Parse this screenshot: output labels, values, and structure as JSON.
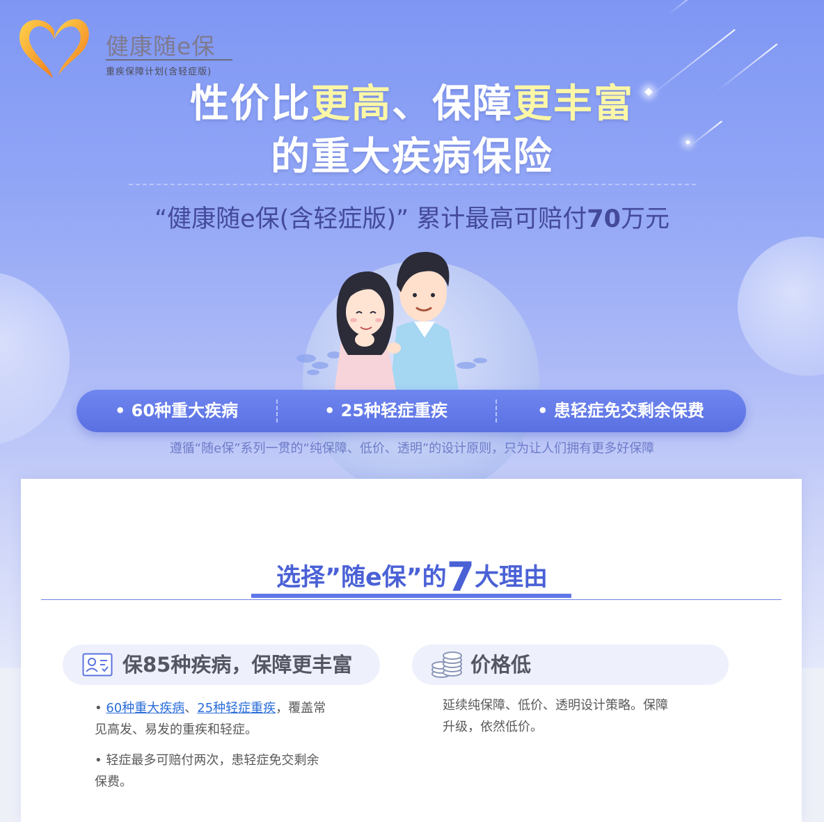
{
  "logo": {
    "name": "健康随e保",
    "subtitle": "重疾保障计划(含轻症版)"
  },
  "headline": {
    "line1_part1": "性价比",
    "line1_hl1": "更高",
    "line1_part2": "、保障",
    "line1_hl2": "更丰富",
    "line2": "的重大疾病保险",
    "highlight_color": "#fbf7a6"
  },
  "claim": {
    "prefix": "“健康随e保(含轻症版)”  累计最高可赔付",
    "amount": "70",
    "unit": "万元"
  },
  "pill": {
    "items": [
      "• 60种重大疾病",
      "• 25种轻症重疾",
      "• 患轻症免交剩余保费"
    ]
  },
  "tagline": "遵循“随e保”系列一贯的“纯保障、低价、透明”的设计原则，只为让人们拥有更多好保障",
  "reasons": {
    "title_prefix": "选择”随e保”的",
    "title_number": "7",
    "title_suffix": "大理由"
  },
  "features": [
    {
      "icon": "id-card-check-icon",
      "title": "保85种疾病，保障更丰富",
      "bullet1_prefix": "• ",
      "bullet1_link1": "60种重大疾病",
      "bullet1_sep": "、",
      "bullet1_link2": "25种轻症重疾",
      "bullet1_rest1": "，覆盖常",
      "bullet1_rest2": "见高发、易发的重疾和轻症。",
      "bullet2_line1": "• 轻症最多可赔付两次，患轻症免交剩余",
      "bullet2_line2": "保费。"
    },
    {
      "icon": "coins-icon",
      "title": "价格低",
      "text_line1": "延续纯保障、低价、透明设计策略。保障",
      "text_line2": "升级，依然低价。"
    }
  ],
  "colors": {
    "accent": "#5f77e8",
    "title": "#4a61d6",
    "link": "#2a6dd9"
  }
}
